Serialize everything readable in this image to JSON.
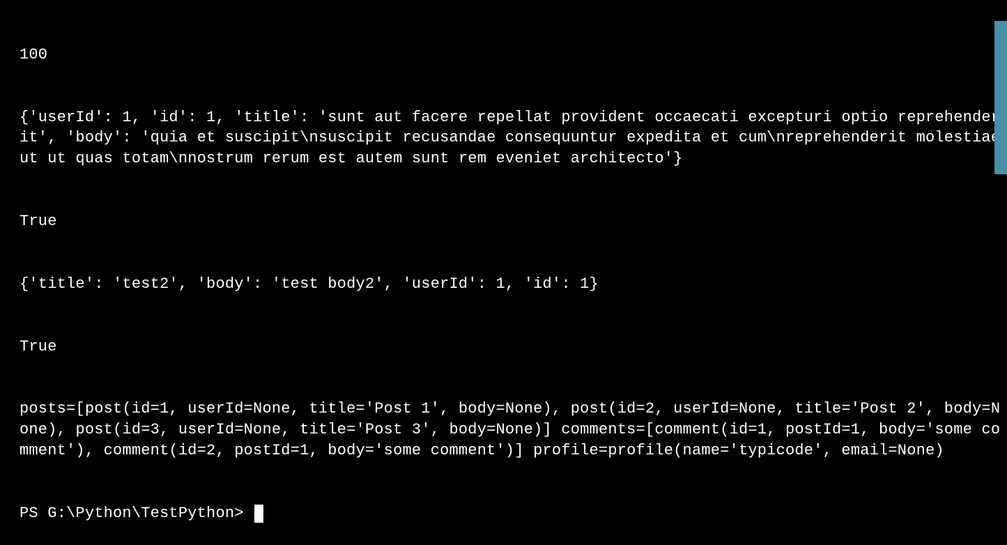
{
  "terminal": {
    "lines": {
      "line1": "100",
      "line2": "{'userId': 1, 'id': 1, 'title': 'sunt aut facere repellat provident occaecati excepturi optio reprehenderit', 'body': 'quia et suscipit\\nsuscipit recusandae consequuntur expedita et cum\\nreprehenderit molestiae ut ut quas totam\\nnostrum rerum est autem sunt rem eveniet architecto'}",
      "line3": "True",
      "line4": "{'title': 'test2', 'body': 'test body2', 'userId': 1, 'id': 1}",
      "line5": "True",
      "line6": "posts=[post(id=1, userId=None, title='Post 1', body=None), post(id=2, userId=None, title='Post 2', body=None), post(id=3, userId=None, title='Post 3', body=None)] comments=[comment(id=1, postId=1, body='some comment'), comment(id=2, postId=1, body='some comment')] profile=profile(name='typicode', email=None)"
    },
    "prompt": "PS G:\\Python\\TestPython> "
  }
}
